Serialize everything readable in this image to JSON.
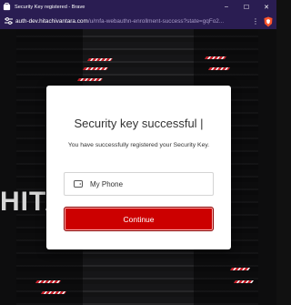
{
  "window": {
    "title": "Security Key registered - Brave",
    "controls": {
      "minimize": "–",
      "maximize": "☐",
      "close": "✕"
    }
  },
  "address_bar": {
    "url_host": "auth-dev.hitachivantara.com",
    "url_path": "/u/mfa-webauthn-enrollment-success?state=gqFo2...",
    "menu_icon": "⋮"
  },
  "background": {
    "brand_text": "HITA"
  },
  "modal": {
    "title": "Security key successful |",
    "message": "You have successfully registered your Security Key.",
    "device": {
      "icon": "phone-icon",
      "name": "My Phone"
    },
    "continue_label": "Continue"
  },
  "colors": {
    "titlebar": "#2a1d52",
    "accent_red": "#cc0000"
  }
}
